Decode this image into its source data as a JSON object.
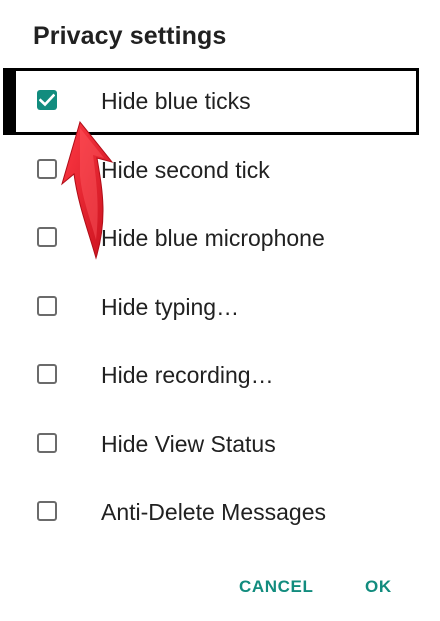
{
  "dialog": {
    "title": "Privacy settings",
    "options": [
      {
        "label": "Hide blue ticks",
        "checked": true
      },
      {
        "label": "Hide second tick",
        "checked": false
      },
      {
        "label": "Hide blue microphone",
        "checked": false
      },
      {
        "label": "Hide typing…",
        "checked": false
      },
      {
        "label": "Hide recording…",
        "checked": false
      },
      {
        "label": "Hide View Status",
        "checked": false
      },
      {
        "label": "Anti-Delete Messages",
        "checked": false
      }
    ],
    "cancel_label": "CANCEL",
    "ok_label": "OK"
  },
  "colors": {
    "accent": "#128c7e",
    "arrow": "#e8202e",
    "highlight_border": "#000000"
  },
  "icons": {
    "checkmark": "check-icon",
    "annotation_arrow": "red-arrow-icon"
  }
}
